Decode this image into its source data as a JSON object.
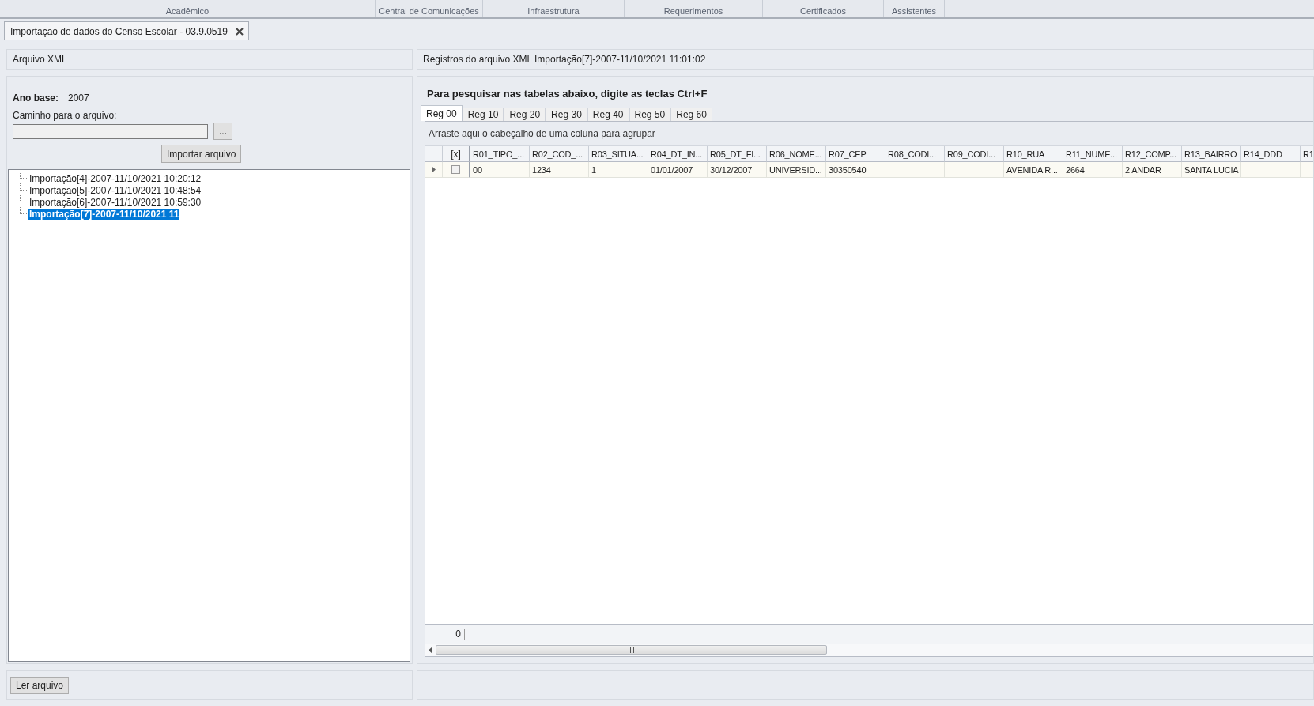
{
  "ribbon_groups": [
    {
      "label": "Acadêmico"
    },
    {
      "label": "Central de Comunicações"
    },
    {
      "label": "Infraestrutura"
    },
    {
      "label": "Requerimentos"
    },
    {
      "label": "Certificados"
    },
    {
      "label": "Assistentes"
    }
  ],
  "document_tab": {
    "title": "Importação de dados do Censo Escolar - 03.9.0519",
    "selected": true
  },
  "left_panel": {
    "header": "Arquivo XML",
    "ano_base_label": "Ano base:",
    "ano_base_value": "2007",
    "path_label": "Caminho para o arquivo:",
    "browse_button": "...",
    "import_button": "Importar arquivo",
    "imports": [
      {
        "label": "Importação[4]-2007-11/10/2021 10:20:12",
        "selected": false
      },
      {
        "label": "Importação[5]-2007-11/10/2021 10:48:54",
        "selected": false
      },
      {
        "label": "Importação[6]-2007-11/10/2021 10:59:30",
        "selected": false
      },
      {
        "label": "Importação[7]-2007-11/10/2021 11",
        "selected": true
      }
    ],
    "read_button": "Ler arquivo"
  },
  "right_panel": {
    "header": "Registros do arquivo XML Importação[7]-2007-11/10/2021 11:01:02",
    "hint": "Para pesquisar nas tabelas abaixo, digite as teclas Ctrl+F",
    "tabs": [
      {
        "label": "Reg 00",
        "selected": true
      },
      {
        "label": "Reg 10",
        "selected": false
      },
      {
        "label": "Reg 20",
        "selected": false
      },
      {
        "label": "Reg 30",
        "selected": false
      },
      {
        "label": "Reg 40",
        "selected": false
      },
      {
        "label": "Reg 50",
        "selected": false
      },
      {
        "label": "Reg 60",
        "selected": false
      }
    ],
    "grid": {
      "group_panel_hint": "Arraste aqui o cabeçalho de uma coluna para agrupar",
      "check_column_header": "[x]",
      "columns": [
        "R01_TIPO_...",
        "R02_COD_...",
        "R03_SITUA...",
        "R04_DT_IN...",
        "R05_DT_FI...",
        "R06_NOME...",
        "R07_CEP",
        "R08_CODI...",
        "R09_CODI...",
        "R10_RUA",
        "R11_NUME...",
        "R12_COMP...",
        "R13_BAIRRO",
        "R14_DDD",
        "R1"
      ],
      "rows": [
        {
          "current": true,
          "checked": false,
          "cells": [
            "00",
            "1234",
            "1",
            "01/01/2007",
            "30/12/2007",
            "UNIVERSID...",
            "30350540",
            "",
            "",
            "AVENIDA R...",
            "2664",
            "2 ANDAR",
            "SANTA LUCIA",
            "",
            ""
          ]
        }
      ],
      "footer_count": "0"
    }
  }
}
